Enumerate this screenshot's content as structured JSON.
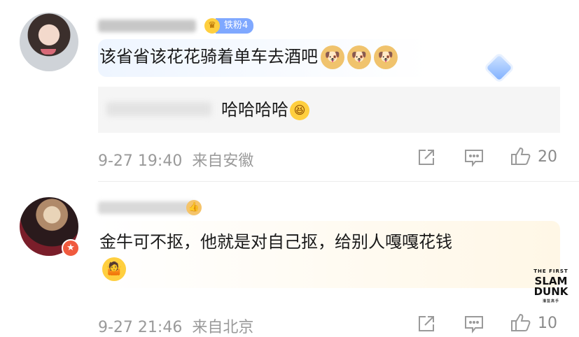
{
  "comments": [
    {
      "badge_label": "铁粉4",
      "text": "该省省该花花骑着单车去酒吧",
      "emojis": [
        "doge",
        "doge",
        "doge"
      ],
      "reply": {
        "text": "哈哈哈哈",
        "emoji": "laugh"
      },
      "timestamp": "9-27 19:40",
      "location": "来自安徽",
      "like_count": "20"
    },
    {
      "text": "金牛可不抠，他就是对自己抠，给别人嘎嘎花钱",
      "emoji": "shrug",
      "timestamp": "9-27 21:46",
      "location": "来自北京",
      "like_count": "10"
    }
  ],
  "watermark": {
    "line1": "THE FIRST",
    "line2": "SLAM",
    "line3": "DUNK",
    "line4": "灌篮高手"
  },
  "icons": [
    "share-icon",
    "comment-icon",
    "like-icon"
  ],
  "colors": {
    "badge_blue": "#7fa8ff",
    "meta_gray": "#9a9a9a",
    "verified_red": "#f05a3e"
  }
}
